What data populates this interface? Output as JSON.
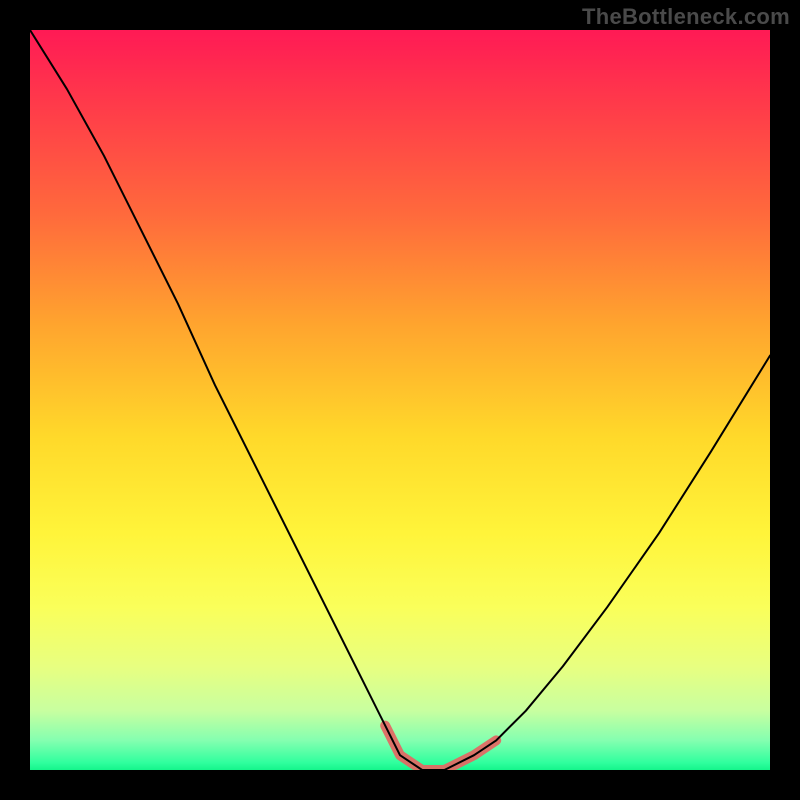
{
  "watermark": "TheBottleneck.com",
  "colors": {
    "page_bg": "#000000",
    "curve_main": "#000000",
    "curve_marker": "#e06a64",
    "gradient_top": "#ff1a55",
    "gradient_bottom": "#14f58b"
  },
  "chart_data": {
    "type": "line",
    "title": "",
    "xlabel": "",
    "ylabel": "",
    "xlim": [
      0,
      100
    ],
    "ylim": [
      0,
      100
    ],
    "grid": false,
    "legend": false,
    "series": [
      {
        "name": "curve",
        "x": [
          0,
          5,
          10,
          15,
          20,
          25,
          30,
          35,
          40,
          45,
          48,
          50,
          53,
          56,
          60,
          63,
          67,
          72,
          78,
          85,
          92,
          100
        ],
        "values": [
          100,
          92,
          83,
          73,
          63,
          52,
          42,
          32,
          22,
          12,
          6,
          2,
          0,
          0,
          2,
          4,
          8,
          14,
          22,
          32,
          43,
          56
        ]
      },
      {
        "name": "highlight",
        "x": [
          48,
          50,
          53,
          56,
          60,
          63
        ],
        "values": [
          6,
          2,
          0,
          0,
          2,
          4
        ]
      }
    ]
  }
}
